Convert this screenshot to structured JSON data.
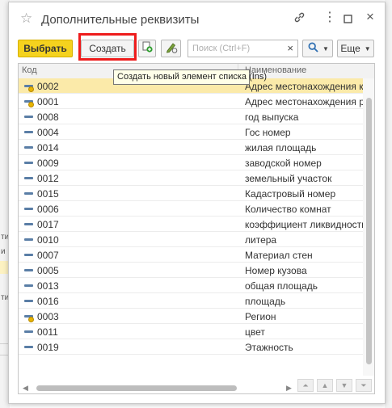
{
  "background": {
    "left_fragments": [
      "ти",
      "и",
      "ти"
    ]
  },
  "window": {
    "title": "Дополнительные реквизиты",
    "icons": [
      "star-icon",
      "link-icon",
      "more-icon",
      "maximize-icon",
      "close-icon"
    ]
  },
  "toolbar": {
    "select_label": "Выбрать",
    "create_label": "Создать",
    "search_placeholder": "Поиск (Ctrl+F)",
    "more_label": "Еще"
  },
  "tooltip": "Создать новый элемент списка (Ins)",
  "table": {
    "columns": [
      "Код",
      "Наименование"
    ],
    "rows": [
      {
        "code": "0002",
        "name": "Адрес местонахождения каз",
        "marked": true,
        "selected": true
      },
      {
        "code": "0001",
        "name": "Адрес местонахождения рус",
        "marked": true,
        "selected": false
      },
      {
        "code": "0008",
        "name": "год выпуска",
        "marked": false,
        "selected": false
      },
      {
        "code": "0004",
        "name": "Гос номер",
        "marked": false,
        "selected": false
      },
      {
        "code": "0014",
        "name": "жилая площадь",
        "marked": false,
        "selected": false
      },
      {
        "code": "0009",
        "name": "заводской номер",
        "marked": false,
        "selected": false
      },
      {
        "code": "0012",
        "name": "земельный участок",
        "marked": false,
        "selected": false
      },
      {
        "code": "0015",
        "name": "Кадастровый номер",
        "marked": false,
        "selected": false
      },
      {
        "code": "0006",
        "name": "Количество комнат",
        "marked": false,
        "selected": false
      },
      {
        "code": "0017",
        "name": "коэффициент ликвидности",
        "marked": false,
        "selected": false
      },
      {
        "code": "0010",
        "name": "литера",
        "marked": false,
        "selected": false
      },
      {
        "code": "0007",
        "name": "Материал стен",
        "marked": false,
        "selected": false
      },
      {
        "code": "0005",
        "name": "Номер кузова",
        "marked": false,
        "selected": false
      },
      {
        "code": "0013",
        "name": "общая площадь",
        "marked": false,
        "selected": false
      },
      {
        "code": "0016",
        "name": "площадь",
        "marked": false,
        "selected": false
      },
      {
        "code": "0003",
        "name": "Регион",
        "marked": true,
        "selected": false
      },
      {
        "code": "0011",
        "name": "цвет",
        "marked": false,
        "selected": false
      },
      {
        "code": "0019",
        "name": "Этажность",
        "marked": false,
        "selected": false
      }
    ]
  },
  "colors": {
    "primary_button": "#f5d21e",
    "selected_row": "#fbeaa9",
    "highlight_frame": "#ee1c1c"
  }
}
